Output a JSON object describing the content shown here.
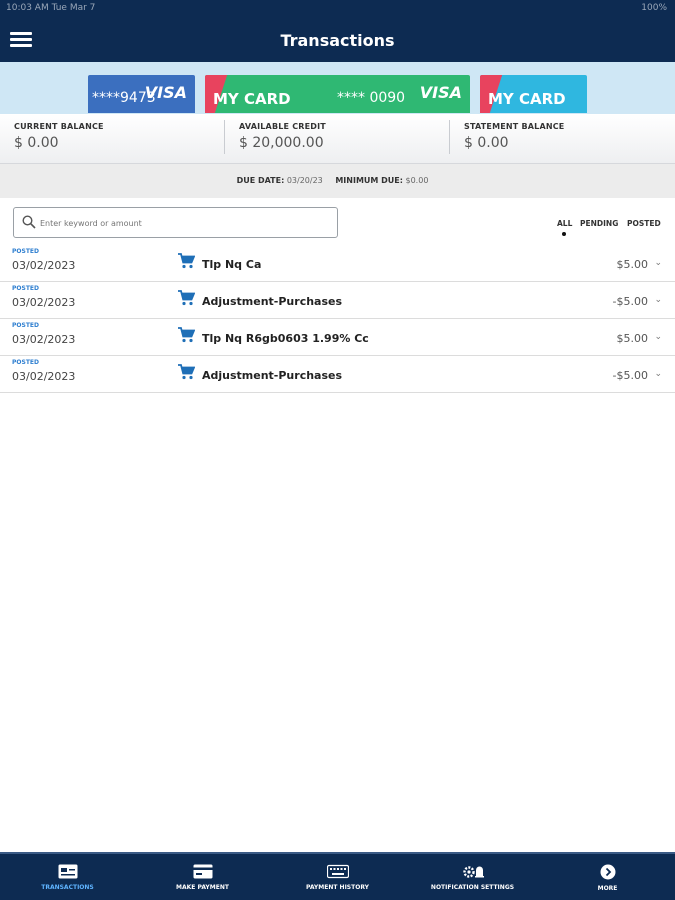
{
  "status_bar": {
    "time": "10:03 AM   Tue Mar 7",
    "battery": "100%"
  },
  "header": {
    "title": "Transactions"
  },
  "cards": [
    {
      "number": "****9473",
      "brand": "VISA"
    },
    {
      "name": "MY CARD",
      "number": "**** 0090",
      "brand": "VISA"
    },
    {
      "name": "MY CARD"
    }
  ],
  "balances": [
    {
      "label": "CURRENT BALANCE",
      "value": "$ 0.00"
    },
    {
      "label": "AVAILABLE CREDIT",
      "value": "$ 20,000.00"
    },
    {
      "label": "STATEMENT BALANCE",
      "value": "$ 0.00"
    }
  ],
  "due": {
    "due_label": "DUE DATE:",
    "due_value": "03/20/23",
    "min_label": "MINIMUM DUE:",
    "min_value": "$0.00"
  },
  "search": {
    "placeholder": "Enter keyword or amount"
  },
  "filters": {
    "all": "ALL",
    "pending": "PENDING",
    "posted": "POSTED",
    "selected": "ALL"
  },
  "transactions": [
    {
      "status": "POSTED",
      "date": "03/02/2023",
      "description": "Tlp Nq Ca",
      "amount": "$5.00"
    },
    {
      "status": "POSTED",
      "date": "03/02/2023",
      "description": "Adjustment-Purchases",
      "amount": "-$5.00"
    },
    {
      "status": "POSTED",
      "date": "03/02/2023",
      "description": "Tlp Nq R6gb0603 1.99% Cc",
      "amount": "$5.00"
    },
    {
      "status": "POSTED",
      "date": "03/02/2023",
      "description": "Adjustment-Purchases",
      "amount": "-$5.00"
    }
  ],
  "tabs": [
    {
      "label": "TRANSACTIONS",
      "icon": "card-list-icon"
    },
    {
      "label": "MAKE PAYMENT",
      "icon": "card-icon"
    },
    {
      "label": "PAYMENT HISTORY",
      "icon": "keyboard-icon"
    },
    {
      "label": "NOTIFICATION SETTINGS",
      "icon": "gear-bell-icon"
    },
    {
      "label": "MORE",
      "icon": "chevron-circle-icon"
    }
  ],
  "colors": {
    "navy": "#0d2b52",
    "accent_blue": "#2f7fd0",
    "active_tab": "#5fb4ff"
  }
}
